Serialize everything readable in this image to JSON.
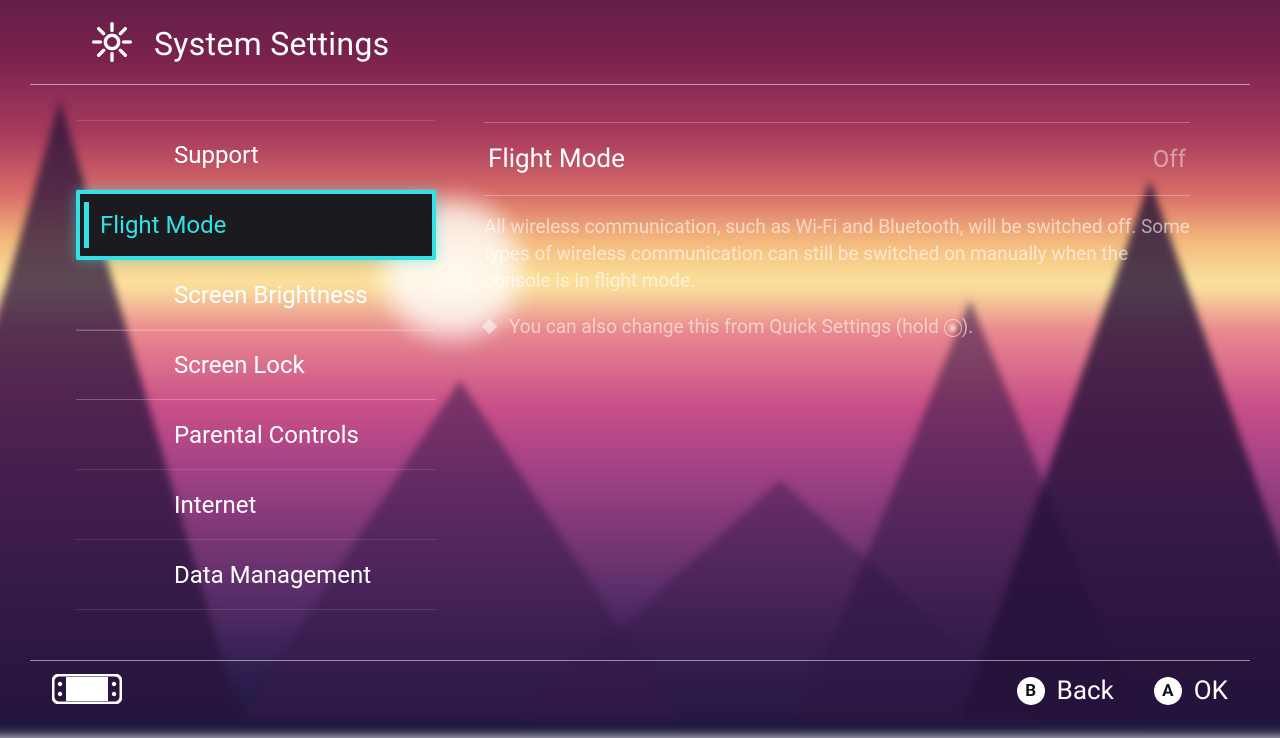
{
  "header": {
    "title": "System Settings"
  },
  "sidebar": {
    "items": [
      {
        "label": "Support"
      },
      {
        "label": "Flight Mode",
        "selected": true
      },
      {
        "label": "Screen Brightness"
      },
      {
        "label": "Screen Lock"
      },
      {
        "label": "Parental Controls"
      },
      {
        "label": "Internet"
      },
      {
        "label": "Data Management"
      }
    ]
  },
  "content": {
    "setting_label": "Flight Mode",
    "setting_value": "Off",
    "description": "All wireless communication, such as Wi-Fi and Bluetooth, will be switched off. Some types of wireless communication can still be switched on manually when the console is in flight mode.",
    "hint_prefix": "You can also change this from Quick Settings (hold ",
    "hint_button_glyph": "◉",
    "hint_suffix": ")."
  },
  "footer": {
    "back": {
      "button": "B",
      "label": "Back"
    },
    "ok": {
      "button": "A",
      "label": "OK"
    }
  }
}
